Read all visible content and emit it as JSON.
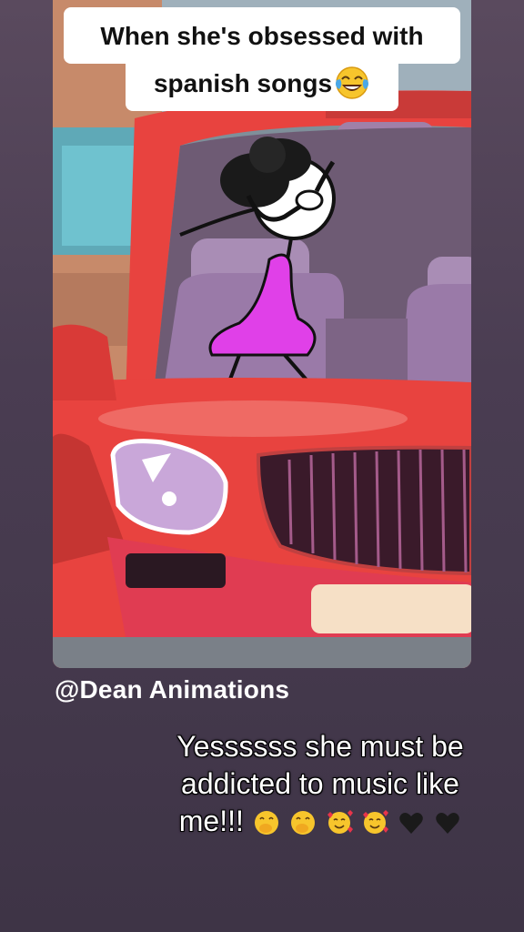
{
  "caption": {
    "line1": "When she's obsessed with",
    "line2": "spanish songs",
    "emoji": "face-with-tears-of-joy"
  },
  "author": {
    "handle": "@Dean Animations"
  },
  "comment": {
    "line1": "Yessssss she must be",
    "line2": "addicted to music like",
    "line3": "me!!!",
    "emojis": [
      "face-with-hand-over-mouth",
      "face-with-hand-over-mouth",
      "smiling-face-with-hearts",
      "smiling-face-with-hearts",
      "black-heart",
      "black-heart"
    ]
  },
  "colors": {
    "background": "#4a3d52",
    "car_red": "#e8433f",
    "dress_magenta": "#e040e8",
    "seat_purple": "#9a7aa8"
  }
}
